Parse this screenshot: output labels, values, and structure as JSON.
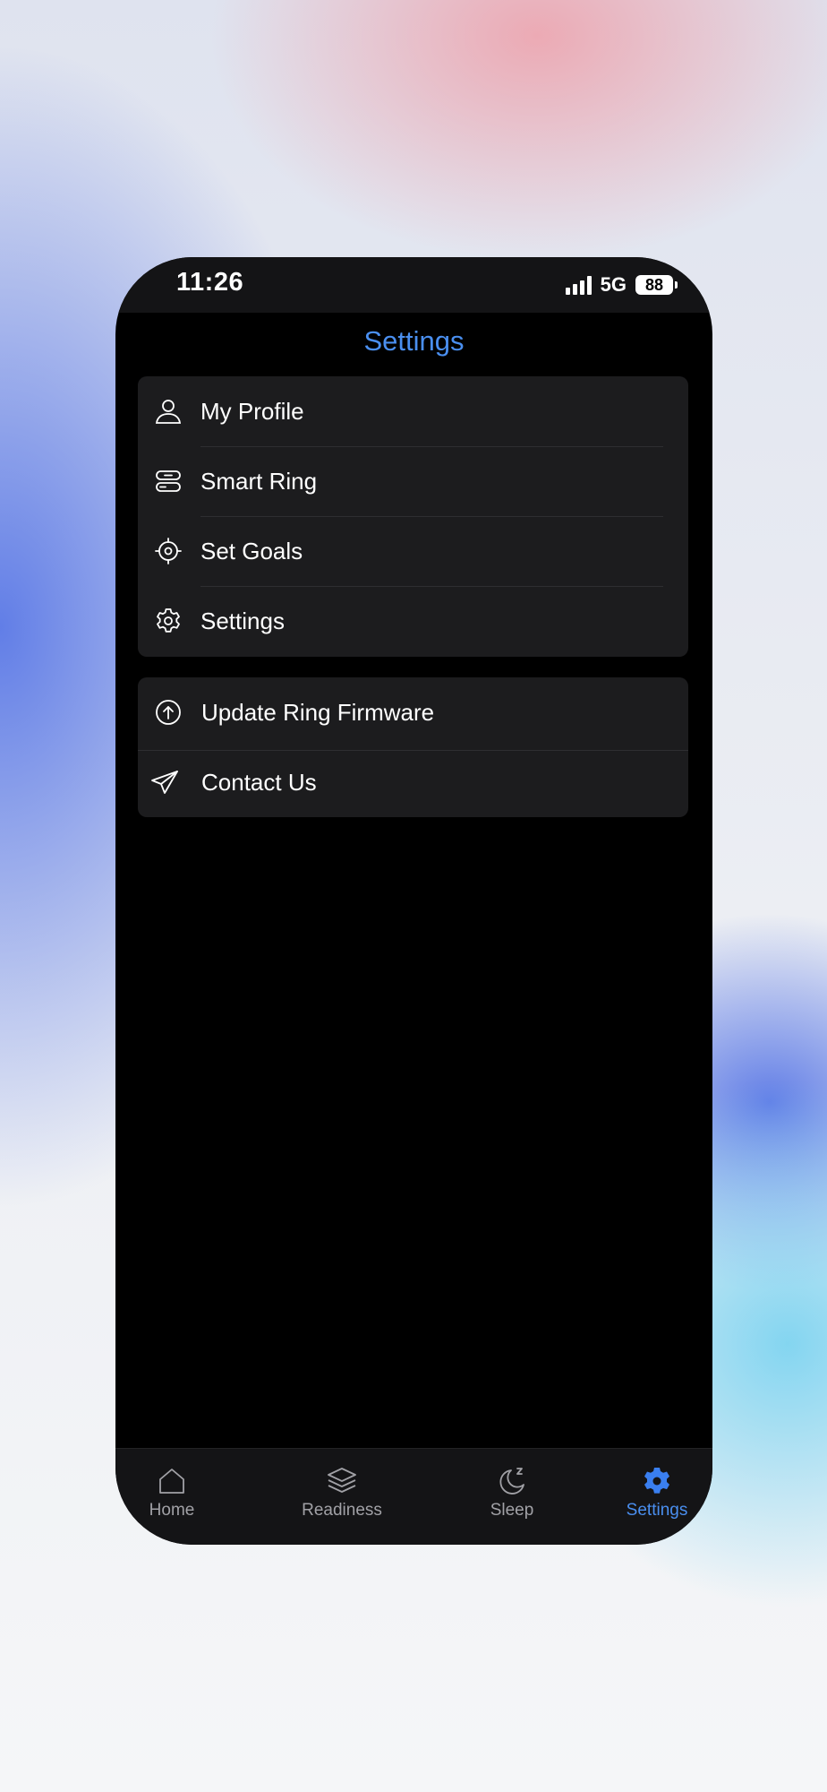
{
  "status_bar": {
    "time": "11:26",
    "network": "5G",
    "battery": "88"
  },
  "header": {
    "title": "Settings"
  },
  "menu_group_1": [
    {
      "label": "My Profile",
      "icon": "person-icon"
    },
    {
      "label": "Smart Ring",
      "icon": "ring-icon"
    },
    {
      "label": "Set Goals",
      "icon": "target-icon"
    },
    {
      "label": "Settings",
      "icon": "gear-icon"
    }
  ],
  "menu_group_2": [
    {
      "label": "Update Ring Firmware",
      "icon": "upload-circle-icon"
    },
    {
      "label": "Contact Us",
      "icon": "paper-plane-icon"
    }
  ],
  "tabbar": {
    "active": "Settings",
    "accent_color": "#4a8ff0",
    "tabs": [
      {
        "label": "Home",
        "icon": "home-icon"
      },
      {
        "label": "Readiness",
        "icon": "layers-icon"
      },
      {
        "label": "Sleep",
        "icon": "moon-icon"
      },
      {
        "label": "Settings",
        "icon": "gear-filled-icon"
      }
    ]
  }
}
